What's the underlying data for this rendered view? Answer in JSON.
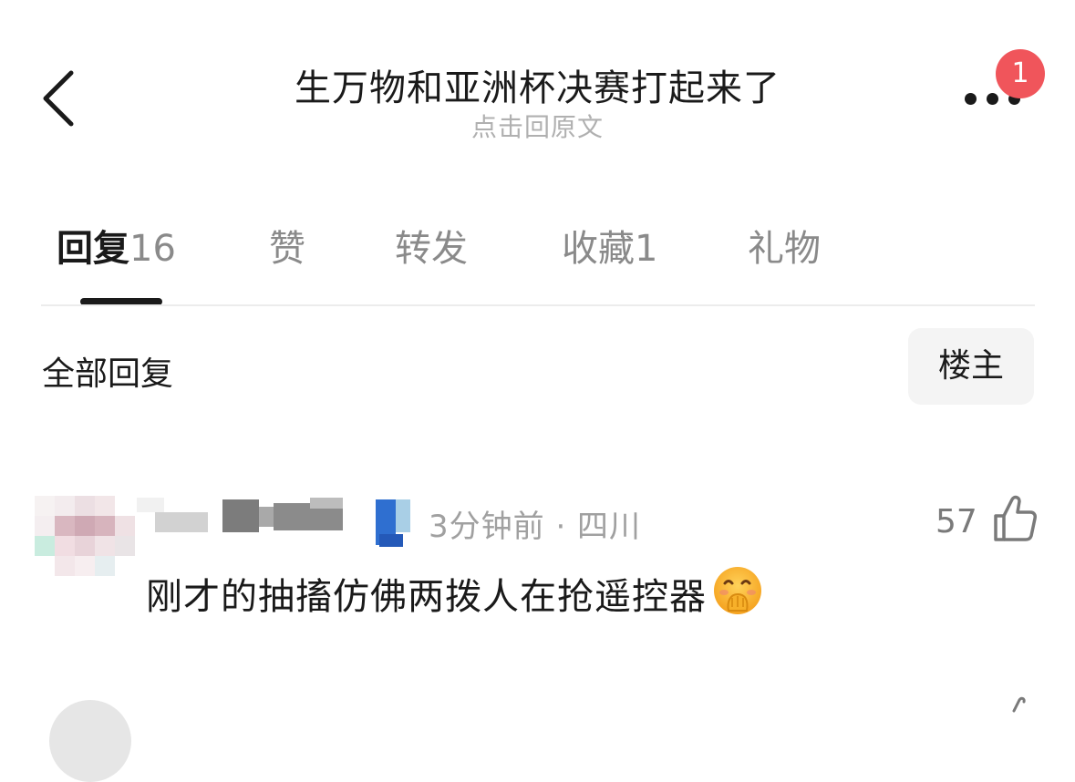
{
  "header": {
    "title": "生万物和亚洲杯决赛打起来了",
    "subtitle": "点击回原文",
    "notification_count": "1"
  },
  "tabs": [
    {
      "label": "回复",
      "count": "16",
      "active": true
    },
    {
      "label": "赞",
      "count": "",
      "active": false
    },
    {
      "label": "转发",
      "count": "",
      "active": false
    },
    {
      "label": "收藏",
      "count": "1",
      "active": false
    },
    {
      "label": "礼物",
      "count": "",
      "active": false
    }
  ],
  "replies_section": {
    "heading": "全部回复",
    "filter_label": "楼主"
  },
  "comments": [
    {
      "username": "",
      "meta": "3分钟前 · 四川",
      "likes": "57",
      "text": "刚才的抽搐仿佛两拨人在抢遥控器",
      "emoji": "hand-over-mouth-emoji"
    }
  ],
  "colors": {
    "badge": "#f0555b",
    "text_primary": "#1a1a1a",
    "text_secondary": "#8a8a8a",
    "meta_gray": "#a0a0a0",
    "button_bg": "#f4f4f4"
  }
}
